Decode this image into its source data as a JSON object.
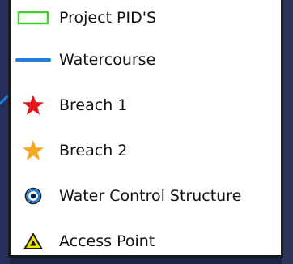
{
  "legend": {
    "items": [
      {
        "label": "Project PID'S",
        "symbol": "green-outline-rectangle",
        "color": "#3fd12a"
      },
      {
        "label": "Watercourse",
        "symbol": "blue-line",
        "color": "#1e7fe0"
      },
      {
        "label": "Breach 1",
        "symbol": "red-star",
        "color": "#e8141c"
      },
      {
        "label": "Breach 2",
        "symbol": "orange-star",
        "color": "#f5a623"
      },
      {
        "label": "Water Control Structure",
        "symbol": "blue-circle-dot",
        "color": "#1e7fe0"
      },
      {
        "label": "Access Point",
        "symbol": "yellow-triangle",
        "color": "#f2e600"
      }
    ]
  }
}
